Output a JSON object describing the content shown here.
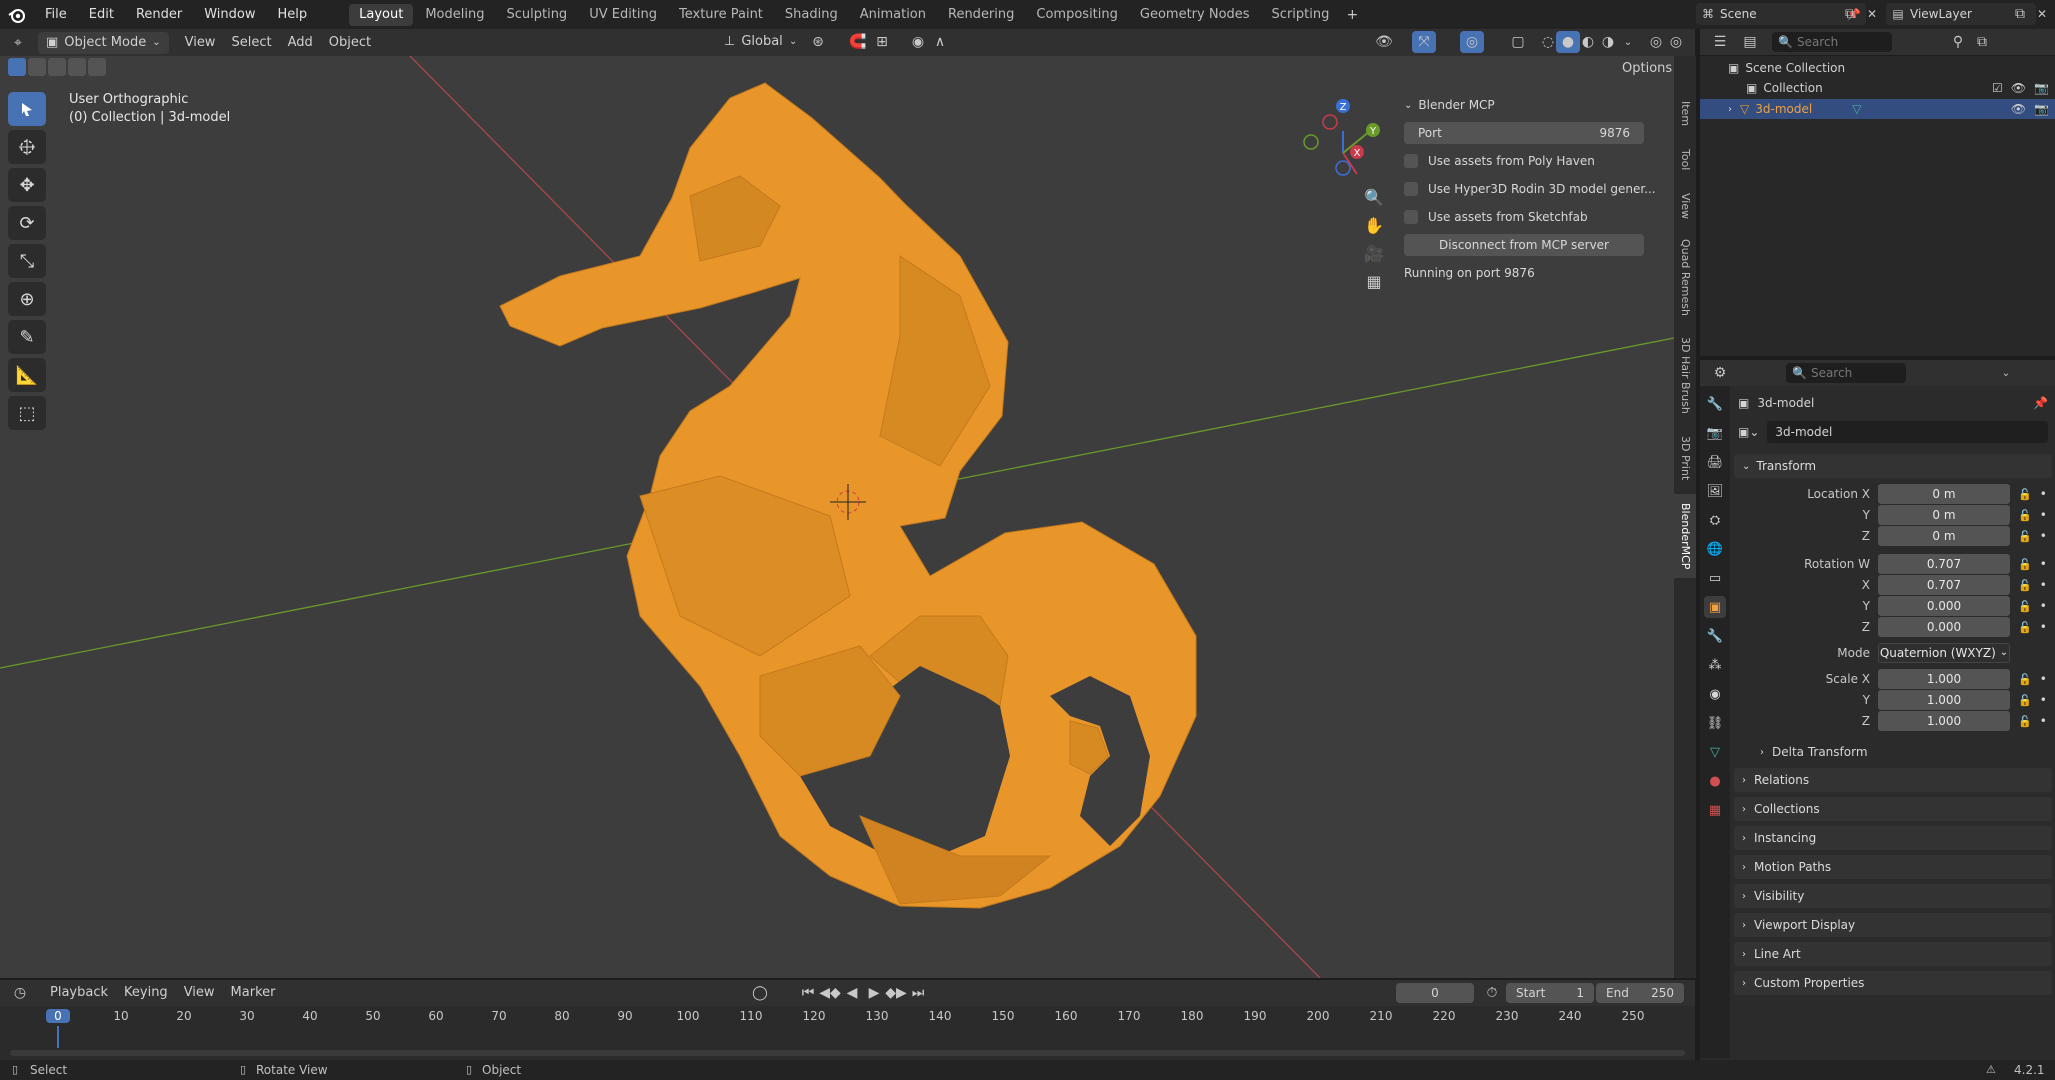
{
  "topbar": {
    "menus": [
      "File",
      "Edit",
      "Render",
      "Window",
      "Help"
    ],
    "workspaces": [
      "Layout",
      "Modeling",
      "Sculpting",
      "UV Editing",
      "Texture Paint",
      "Shading",
      "Animation",
      "Rendering",
      "Compositing",
      "Geometry Nodes",
      "Scripting"
    ],
    "active_workspace": "Layout",
    "scene": "Scene",
    "view_layer": "ViewLayer"
  },
  "viewport_header": {
    "mode": "Object Mode",
    "menus": [
      "View",
      "Select",
      "Add",
      "Object"
    ],
    "orientation": "Global",
    "options_label": "Options"
  },
  "viewport": {
    "view_name": "User Orthographic",
    "collection_info": "(0) Collection | 3d-model"
  },
  "npanel": {
    "title": "Blender MCP",
    "port_label": "Port",
    "port_value": "9876",
    "options": [
      "Use assets from Poly Haven",
      "Use Hyper3D Rodin 3D model gener...",
      "Use assets from Sketchfab"
    ],
    "disconnect_label": "Disconnect from MCP server",
    "status": "Running on port 9876",
    "side_tabs": [
      "Item",
      "Tool",
      "View",
      "Quad Remesh",
      "3D Hair Brush",
      "3D Print",
      "BlenderMCP"
    ]
  },
  "outliner": {
    "search_placeholder": "Search",
    "scene_collection": "Scene Collection",
    "collection": "Collection",
    "object": "3d-model"
  },
  "properties": {
    "search_placeholder": "Search",
    "object_name": "3d-model",
    "datablock_name": "3d-model",
    "transform_title": "Transform",
    "location": {
      "label": "Location X",
      "x": "0 m",
      "y": "0 m",
      "z": "0 m"
    },
    "rotation": {
      "label": "Rotation W",
      "w": "0.707",
      "x": "0.707",
      "y": "0.000",
      "z": "0.000"
    },
    "mode_label": "Mode",
    "mode_value": "Quaternion (WXYZ)",
    "scale": {
      "label": "Scale X",
      "x": "1.000",
      "y": "1.000",
      "z": "1.000"
    },
    "axis_y": "Y",
    "axis_z": "Z",
    "axis_x": "X",
    "delta_transform": "Delta Transform",
    "sections": [
      "Relations",
      "Collections",
      "Instancing",
      "Motion Paths",
      "Visibility",
      "Viewport Display",
      "Line Art",
      "Custom Properties"
    ]
  },
  "timeline": {
    "menus": [
      "Playback",
      "Keying",
      "View",
      "Marker"
    ],
    "current_frame": "0",
    "start_label": "Start",
    "start_value": "1",
    "end_label": "End",
    "end_value": "250",
    "ticks": [
      "0",
      "10",
      "20",
      "30",
      "40",
      "50",
      "60",
      "70",
      "80",
      "90",
      "100",
      "110",
      "120",
      "130",
      "140",
      "150",
      "160",
      "170",
      "180",
      "190",
      "200",
      "210",
      "220",
      "230",
      "240",
      "250"
    ]
  },
  "statusbar": {
    "select": "Select",
    "rotate": "Rotate View",
    "object": "Object",
    "version": "4.2.1"
  },
  "colors": {
    "accent": "#4772b3",
    "model_orange": "#e8952a",
    "x_axis": "#b04040",
    "y_axis": "#6a9a2a"
  }
}
